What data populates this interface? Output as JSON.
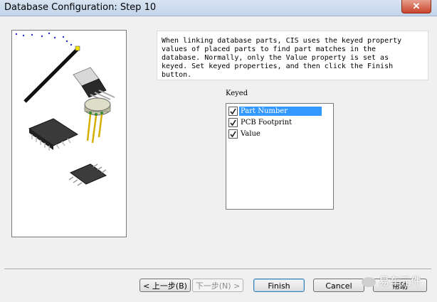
{
  "window": {
    "title": "Database Configuration: Step 10",
    "close_glyph": "✕"
  },
  "instructions": {
    "text": "When linking database parts, CIS uses the keyed property\nvalues of placed parts to find part matches in the\ndatabase. Normally, only the Value property is set as\nkeyed. Set keyed properties, and then click the Finish\nbutton."
  },
  "keyed": {
    "label": "Keyed",
    "items": [
      {
        "label": "Part Number",
        "checked": true,
        "selected": true
      },
      {
        "label": "PCB Footprint",
        "checked": true,
        "selected": false
      },
      {
        "label": "Value",
        "checked": true,
        "selected": false
      }
    ]
  },
  "buttons": {
    "back": "< 上一步(B)",
    "next": "下一步(N) >",
    "finish": "Finish",
    "cancel": "Cancel",
    "help": "帮助"
  },
  "watermark": {
    "text": "易车元件"
  },
  "colors": {
    "selection": "#3399ff",
    "title_gradient_top": "#d9e4f1",
    "close_button": "#c7442b"
  },
  "illustration": {
    "icon": "electronic-components-illustration"
  }
}
